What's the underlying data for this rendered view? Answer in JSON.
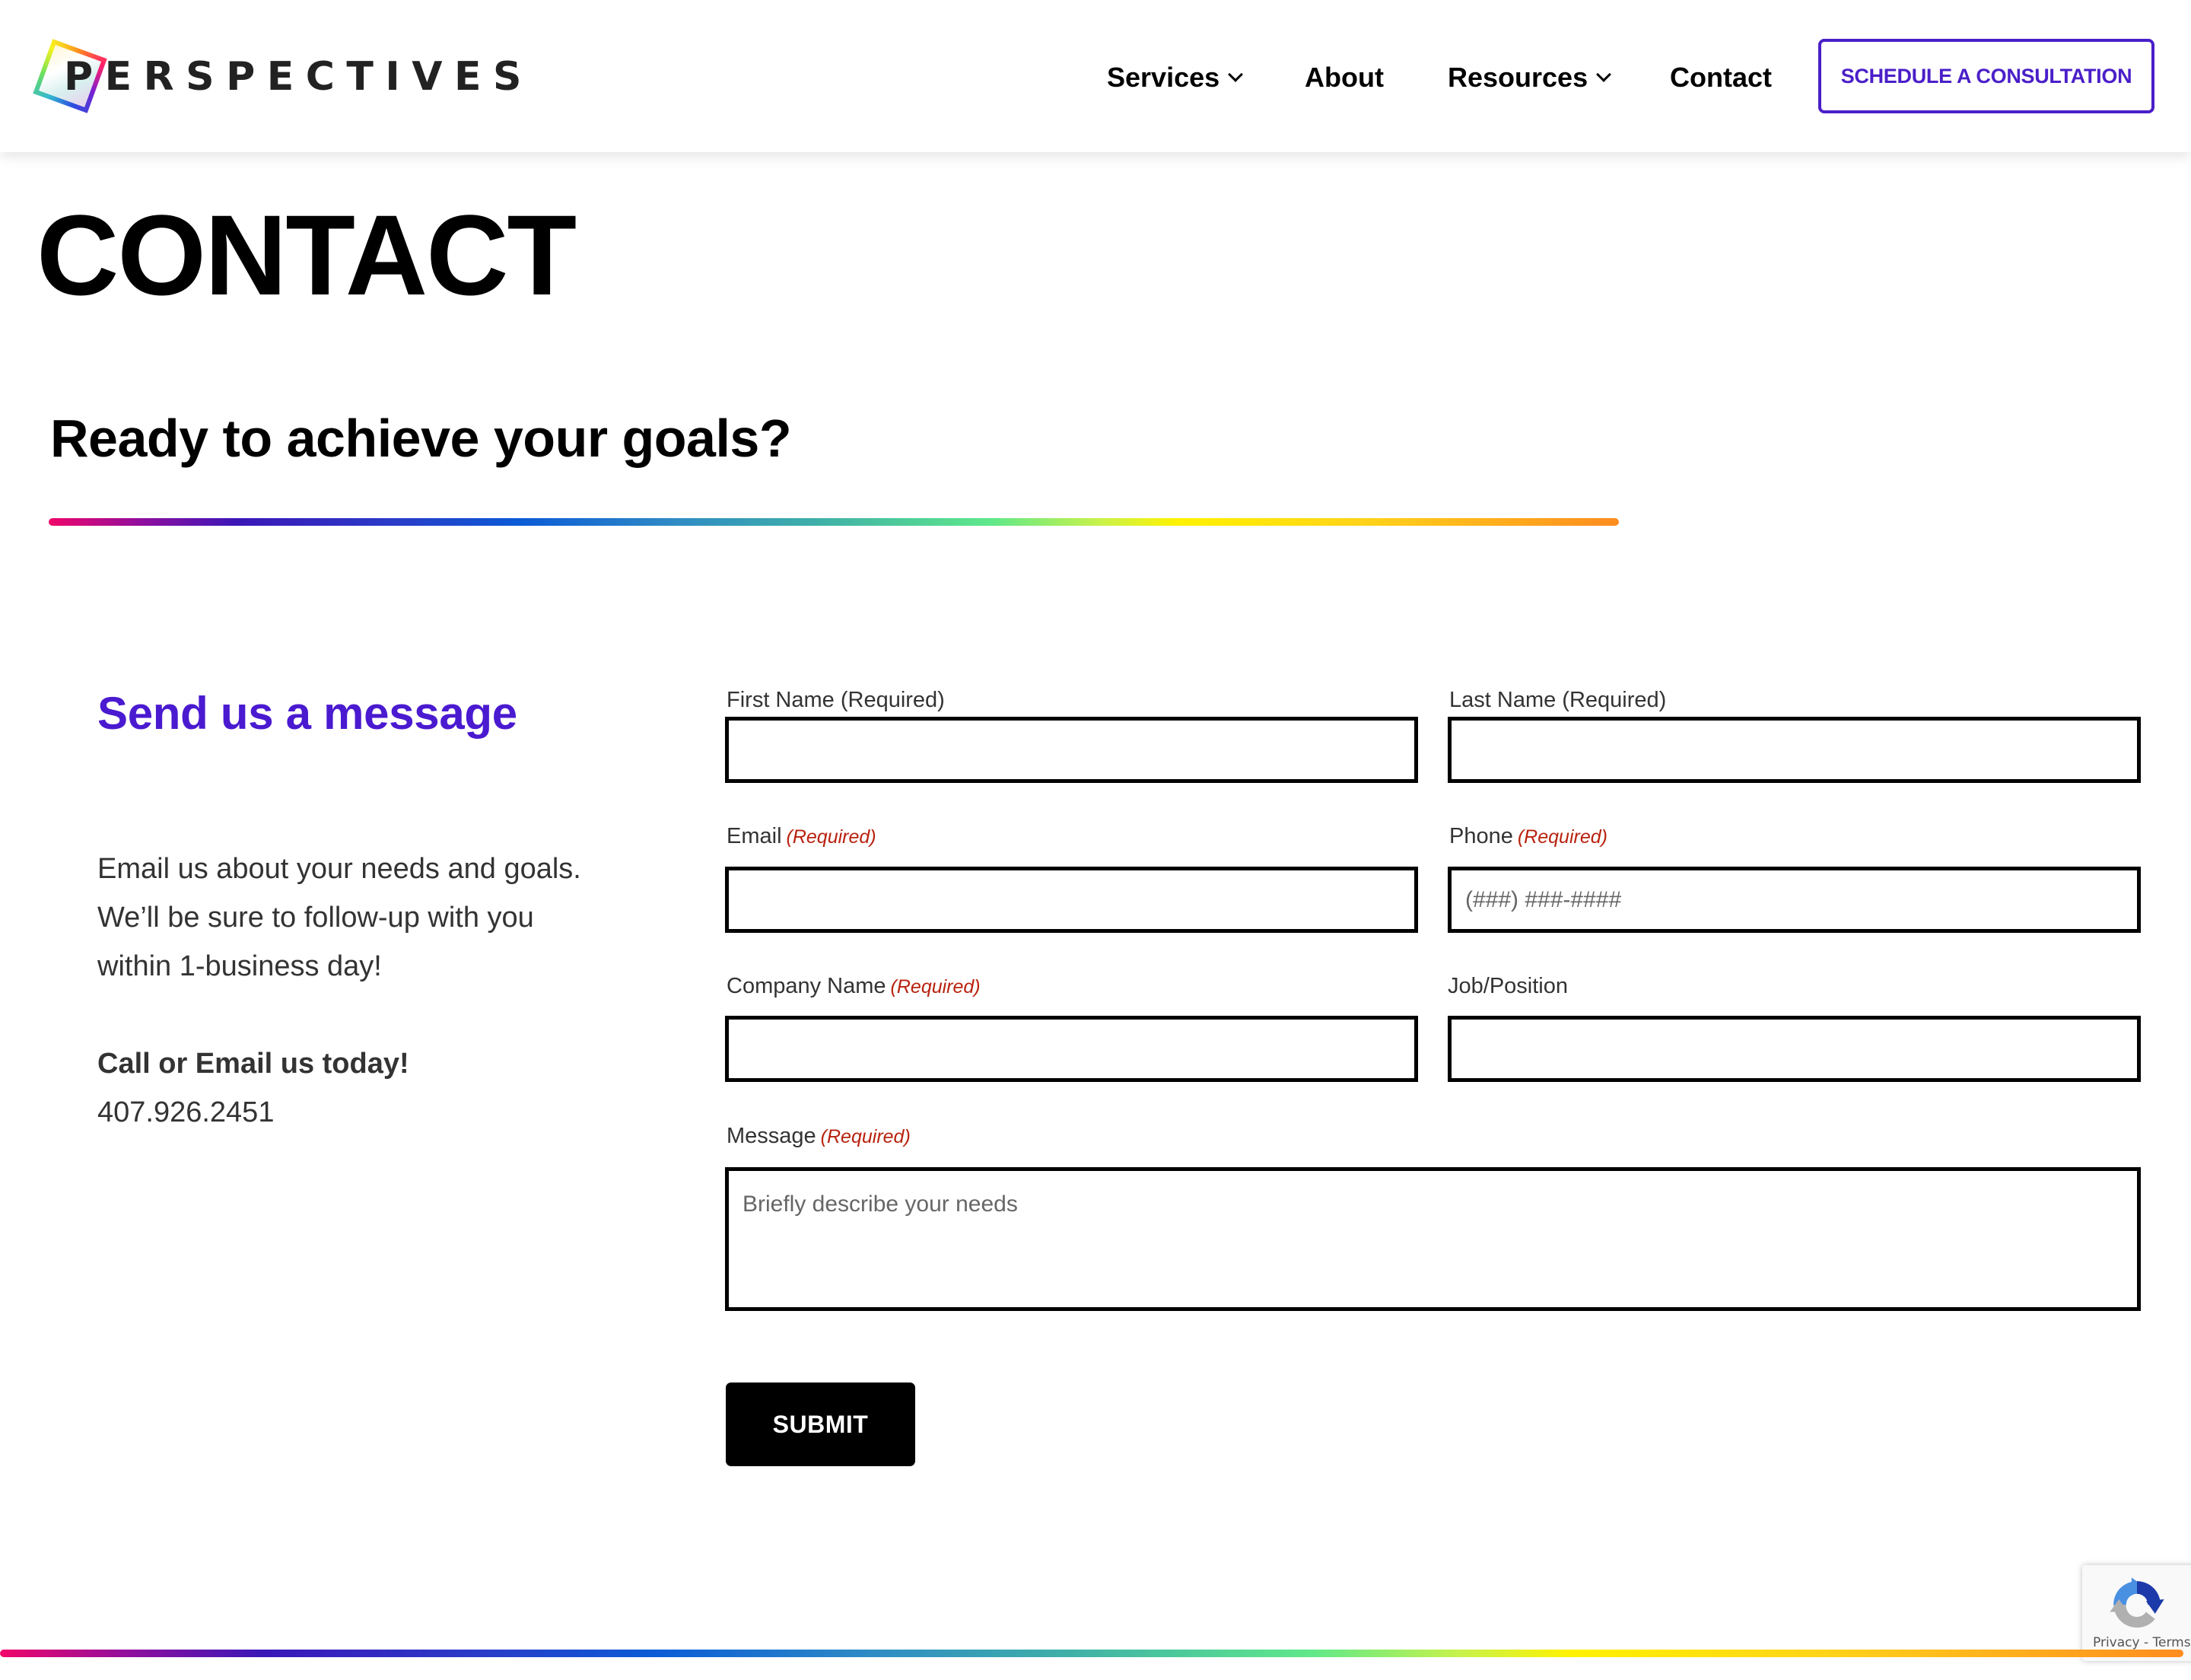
{
  "header": {
    "logo_text": "PERSPECTIVES",
    "nav": [
      {
        "label": "Services",
        "has_dropdown": true
      },
      {
        "label": "About",
        "has_dropdown": false
      },
      {
        "label": "Resources",
        "has_dropdown": true
      },
      {
        "label": "Contact",
        "has_dropdown": false
      }
    ],
    "cta_label": "SCHEDULE A CONSULTATION"
  },
  "page": {
    "title": "CONTACT",
    "tagline": "Ready to achieve your goals?"
  },
  "sidebar": {
    "heading": "Send us a message",
    "intro_lines": [
      "Email us about your needs and goals.",
      "We’ll be sure to follow-up with you",
      "within 1-business day!"
    ],
    "call_heading": "Call or Email us today!",
    "phone": "407.926.2451"
  },
  "form": {
    "fields": {
      "first_name": {
        "label": "First Name (Required)",
        "required_tag": "",
        "value": "",
        "placeholder": ""
      },
      "last_name": {
        "label": "Last Name (Required)",
        "required_tag": "",
        "value": "",
        "placeholder": ""
      },
      "email": {
        "label": "Email",
        "required_tag": "(Required)",
        "value": "",
        "placeholder": ""
      },
      "phone": {
        "label": "Phone",
        "required_tag": "(Required)",
        "value": "",
        "placeholder": "(###) ###-####"
      },
      "company": {
        "label": "Company Name",
        "required_tag": "(Required)",
        "value": "",
        "placeholder": ""
      },
      "job": {
        "label": "Job/Position",
        "required_tag": "",
        "value": "",
        "placeholder": ""
      },
      "message": {
        "label": "Message",
        "required_tag": "(Required)",
        "value": "",
        "placeholder": "Briefly describe your needs"
      }
    },
    "submit_label": "SUBMIT"
  },
  "recaptcha": {
    "links": "Privacy - Terms"
  },
  "colors": {
    "brand_purple": "#4a1fc8",
    "heading_purple": "#4a1ad0",
    "required_red": "#b8220f",
    "text_dark": "#333333"
  }
}
